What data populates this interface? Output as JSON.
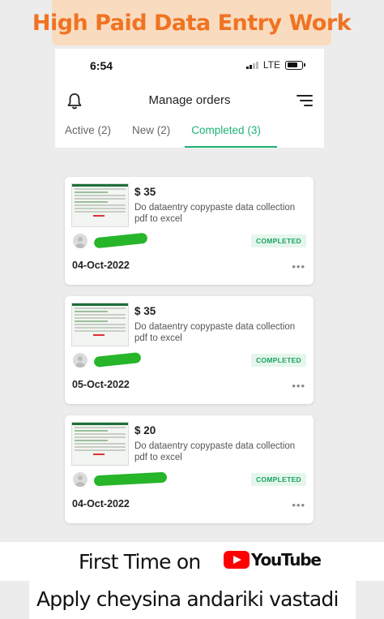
{
  "banner_top": "High Paid Data Entry Work",
  "status": {
    "time": "6:54",
    "network": "LTE"
  },
  "header": {
    "title": "Manage orders"
  },
  "tabs": [
    {
      "label": "Active (2)"
    },
    {
      "label": "New (2)"
    },
    {
      "label": "Completed (3)"
    }
  ],
  "orders": [
    {
      "price": "$ 35",
      "description": "Do dataentry copypaste data collection pdf to excel",
      "status": "COMPLETED",
      "date": "04-Oct-2022"
    },
    {
      "price": "$ 35",
      "description": "Do dataentry copypaste data collection pdf to excel",
      "status": "COMPLETED",
      "date": "05-Oct-2022"
    },
    {
      "price": "$ 20",
      "description": "Do dataentry copypaste data collection pdf to excel",
      "status": "COMPLETED",
      "date": "04-Oct-2022"
    }
  ],
  "more_label": "•••",
  "footer": {
    "line1": "First Time on",
    "youtube": "YouTube",
    "line2": "Apply cheysina andariki vastadi"
  },
  "colors": {
    "accent": "#1db373",
    "banner_text": "#f07322",
    "banner_bg": "#f9dcc0",
    "youtube_red": "#ff0000"
  }
}
